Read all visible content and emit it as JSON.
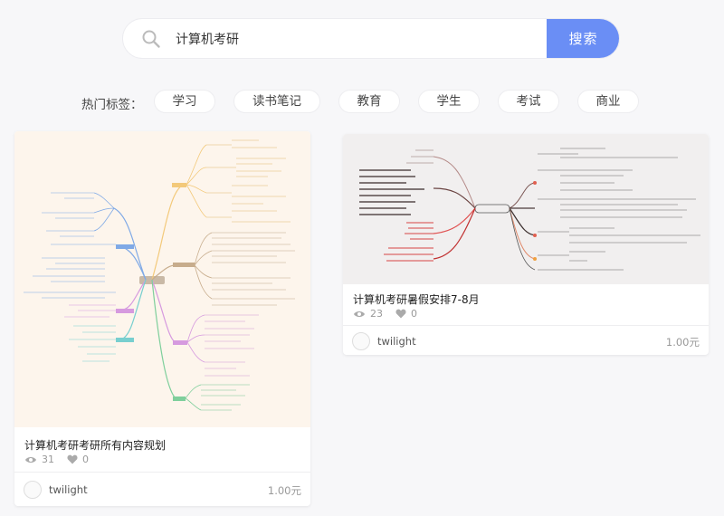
{
  "search": {
    "value": "计算机考研",
    "button_label": "搜索"
  },
  "tags": {
    "label": "热门标签：",
    "items": [
      "学习",
      "读书笔记",
      "教育",
      "学生",
      "考试",
      "商业"
    ]
  },
  "cards": [
    {
      "title": "计算机考研考研所有内容规划",
      "views": "31",
      "likes": "0",
      "author": "twilight",
      "price": "1.00元"
    },
    {
      "title": "计算机考研暑假安排7-8月",
      "views": "23",
      "likes": "0",
      "author": "twilight",
      "price": "1.00元"
    }
  ],
  "colors": {
    "accent": "#6a8ef5",
    "thumb1_bg": "#fdf5ec",
    "thumb2_bg": "#f1efef"
  },
  "icons": {
    "search": "search-icon",
    "views": "eye-icon",
    "likes": "heart-icon"
  }
}
